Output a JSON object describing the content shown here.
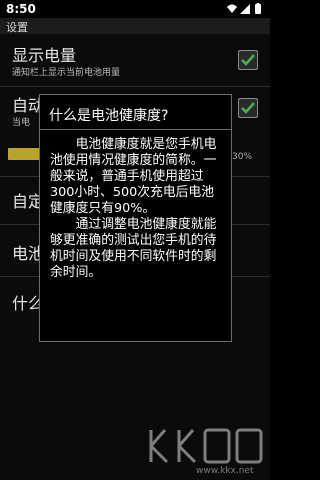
{
  "status_bar": {
    "time": "8:50",
    "icons": [
      "wifi-icon",
      "signal-icon",
      "battery-icon"
    ]
  },
  "app_bar": {
    "title": "设置"
  },
  "settings": {
    "items": [
      {
        "title": "显示电量",
        "summary": "通知栏上显示当前电池用量",
        "checked": true
      },
      {
        "title": "自动",
        "summary": "当电",
        "checked": true
      },
      {
        "progress_label": "30%",
        "progress_fraction": 0.3
      },
      {
        "title": "自定"
      },
      {
        "title": "电池"
      },
      {
        "title": "什么"
      }
    ]
  },
  "dialog": {
    "title": "什么是电池健康度?",
    "paragraphs": [
      "电池健康度就是您手机电池使用情况健康度的简称。一般来说，普通手机使用超过300小时、500次充电后电池健康度只有90%。",
      "通过调整电池健康度就能够更准确的测试出您手机的待机时间及使用不同软件时的剩余时间。"
    ]
  },
  "watermark": {
    "url": "www.kkx.net"
  },
  "colors": {
    "checkbox_check": "#4caf50",
    "progress_fill": "#b8a42a",
    "dialog_border": "#6c6c6c"
  }
}
